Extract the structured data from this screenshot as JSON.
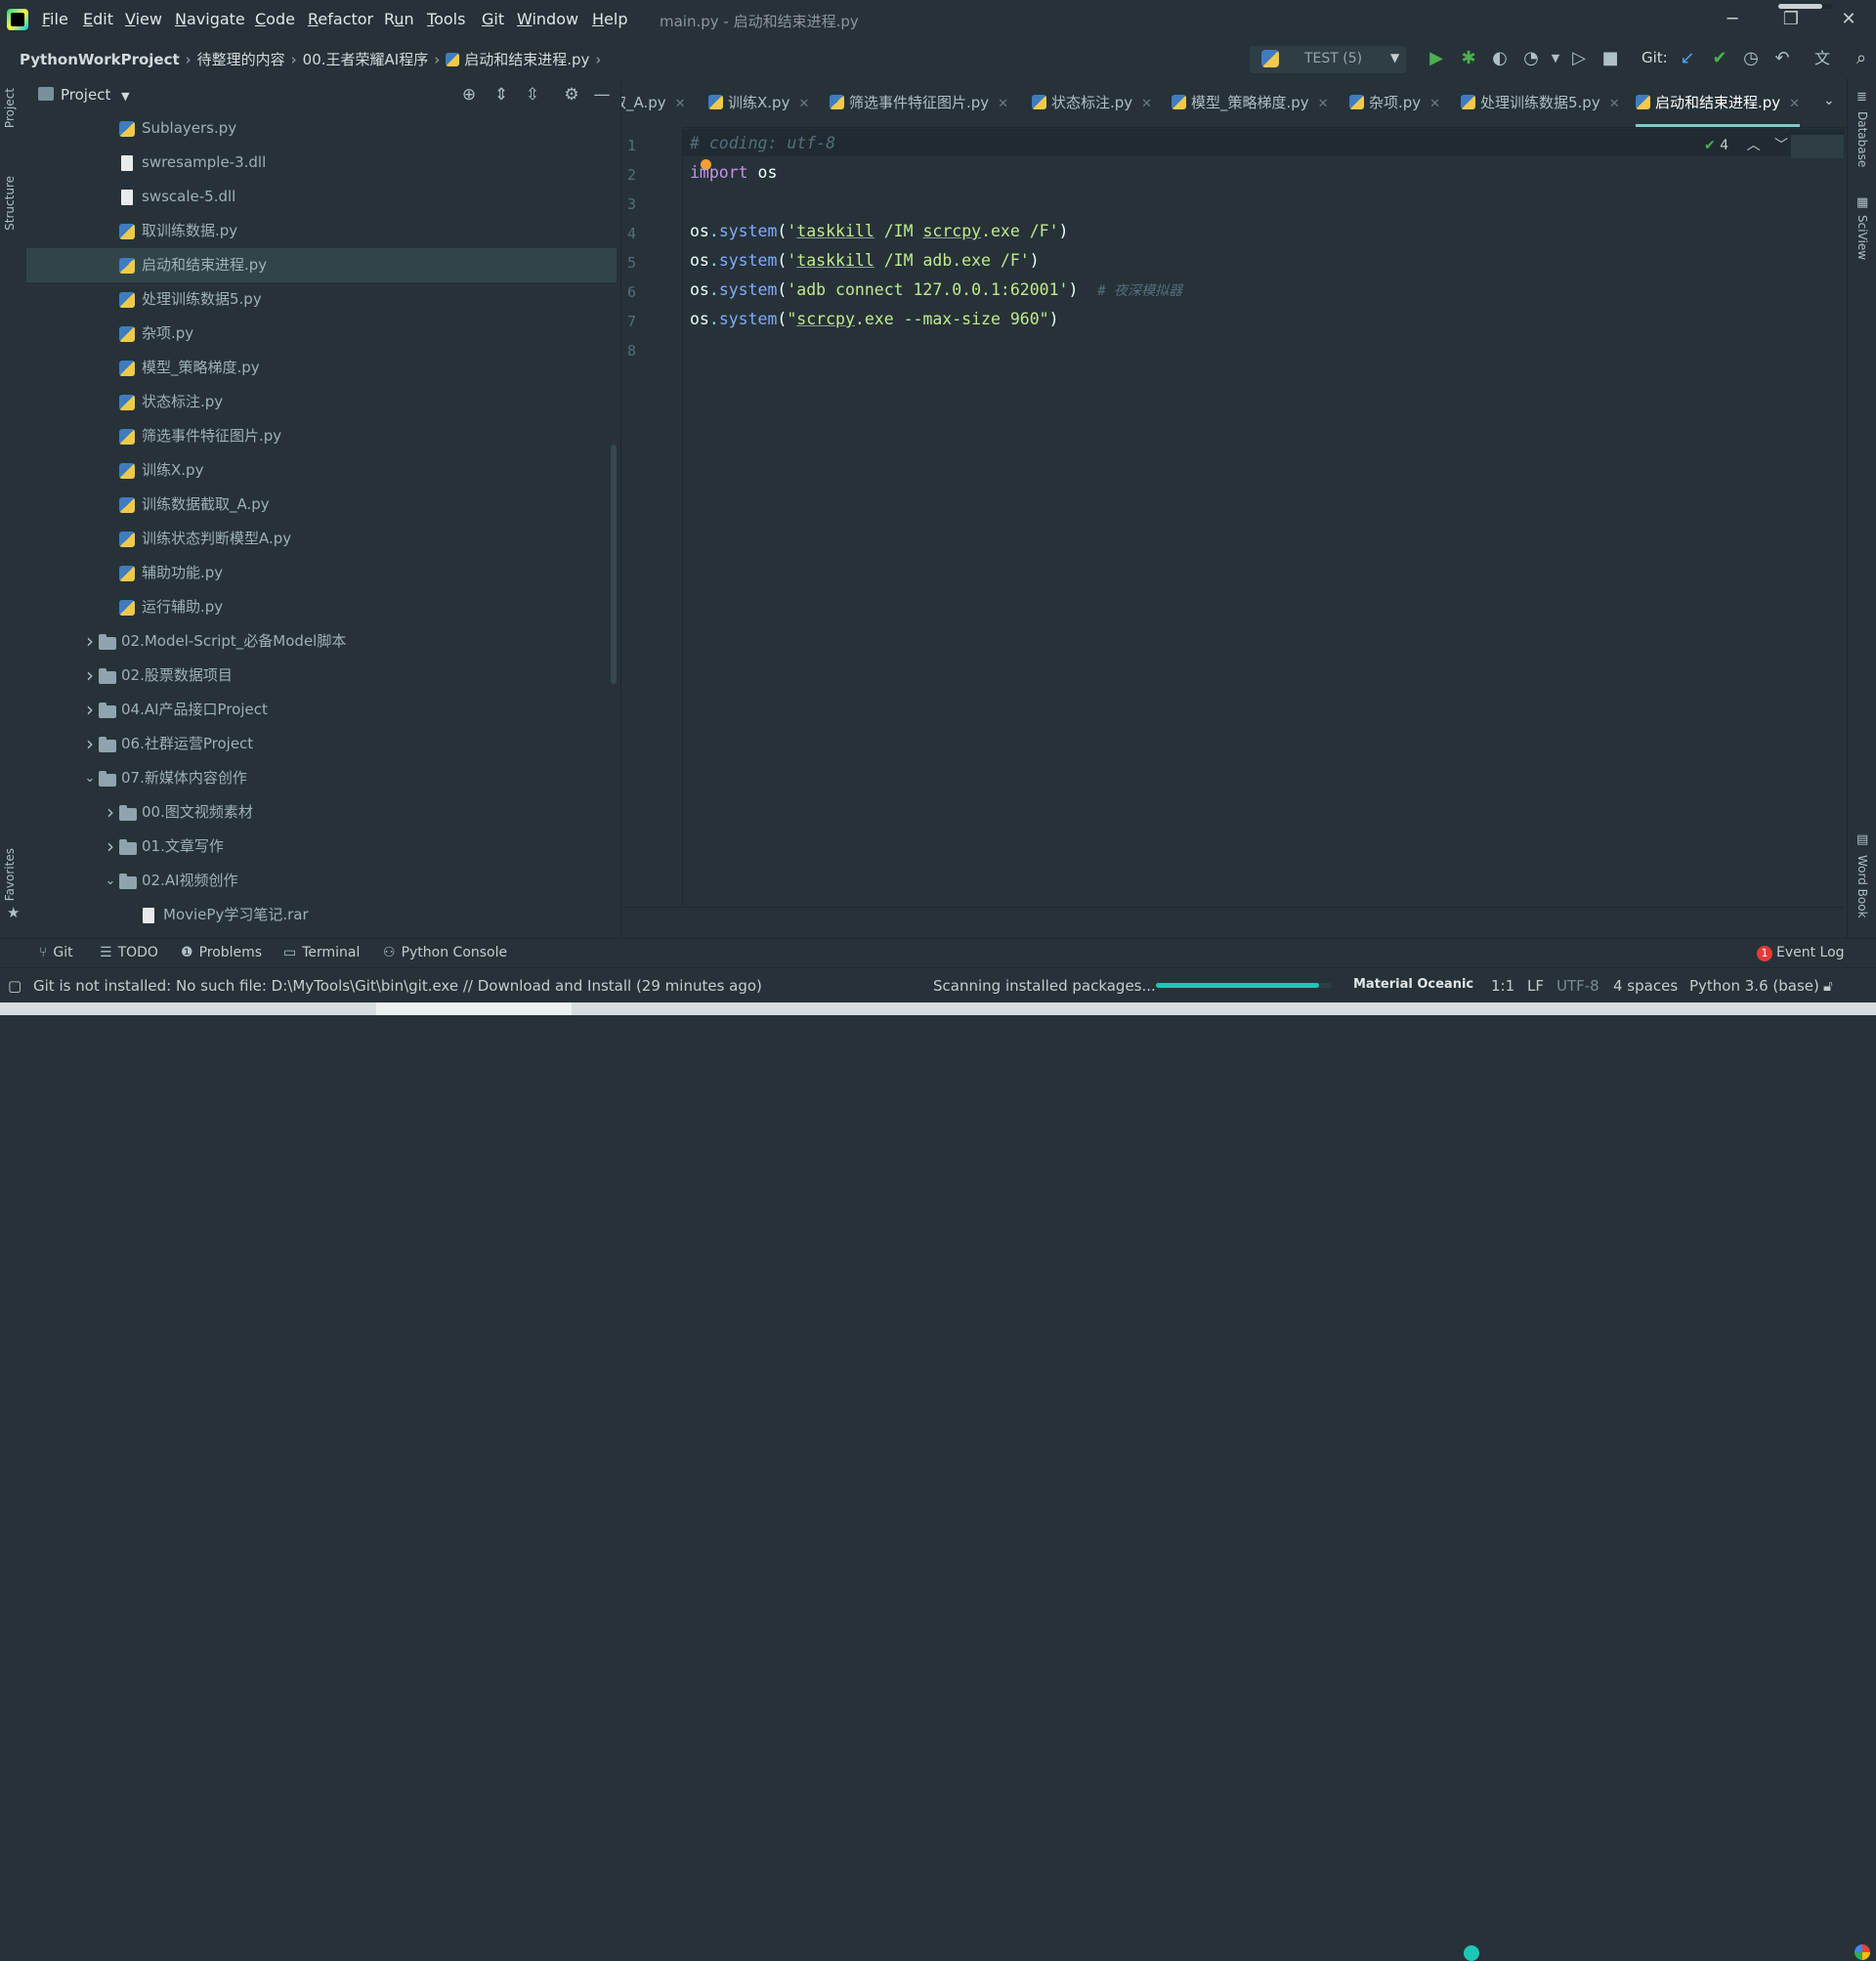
{
  "window": {
    "title": "main.py - 启动和结束进程.py",
    "minimize": "─",
    "restore": "❐",
    "close": "✕",
    "progress": 0.8
  },
  "menu": [
    {
      "pre": "",
      "u": "F",
      "post": "ile"
    },
    {
      "pre": "",
      "u": "E",
      "post": "dit"
    },
    {
      "pre": "",
      "u": "V",
      "post": "iew"
    },
    {
      "pre": "",
      "u": "N",
      "post": "avigate"
    },
    {
      "pre": "",
      "u": "C",
      "post": "ode"
    },
    {
      "pre": "",
      "u": "R",
      "post": "efactor"
    },
    {
      "pre": "R",
      "u": "u",
      "post": "n"
    },
    {
      "pre": "",
      "u": "T",
      "post": "ools"
    },
    {
      "pre": "",
      "u": "G",
      "post": "it"
    },
    {
      "pre": "",
      "u": "W",
      "post": "indow"
    },
    {
      "pre": "",
      "u": "H",
      "post": "elp"
    }
  ],
  "breadcrumb": {
    "project": "PythonWorkProject",
    "folder1": "待整理的内容",
    "folder2": "00.王者荣耀AI程序",
    "file": "启动和结束进程.py"
  },
  "toolbar": {
    "run_config": "TEST (5)",
    "git_label": "Git:"
  },
  "left_tabs": {
    "project": "Project",
    "structure": "Structure",
    "favorites": "Favorites"
  },
  "project_panel": {
    "title": "Project",
    "tree": [
      {
        "label": "Sublayers.py",
        "type": "py"
      },
      {
        "label": "swresample-3.dll",
        "type": "file"
      },
      {
        "label": "swscale-5.dll",
        "type": "file"
      },
      {
        "label": "取训练数据.py",
        "type": "py"
      },
      {
        "label": "启动和结束进程.py",
        "type": "py"
      },
      {
        "label": "处理训练数据5.py",
        "type": "py"
      },
      {
        "label": "杂项.py",
        "type": "py"
      },
      {
        "label": "模型_策略梯度.py",
        "type": "py"
      },
      {
        "label": "状态标注.py",
        "type": "py"
      },
      {
        "label": "筛选事件特征图片.py",
        "type": "py"
      },
      {
        "label": "训练X.py",
        "type": "py"
      },
      {
        "label": "训练数据截取_A.py",
        "type": "py"
      },
      {
        "label": "训练状态判断模型A.py",
        "type": "py"
      },
      {
        "label": "辅助功能.py",
        "type": "py"
      },
      {
        "label": "运行辅助.py",
        "type": "py"
      },
      {
        "label": "02.Model-Script_必备Model脚本",
        "type": "folder"
      },
      {
        "label": "02.股票数据项目",
        "type": "folder"
      },
      {
        "label": "04.AI产品接口Project",
        "type": "folder"
      },
      {
        "label": "06.社群运营Project",
        "type": "folder"
      },
      {
        "label": "07.新媒体内容创作",
        "type": "folder"
      },
      {
        "label": "00.图文视频素材",
        "type": "folder"
      },
      {
        "label": "01.文章写作",
        "type": "folder"
      },
      {
        "label": "02.AI视频创作",
        "type": "folder"
      },
      {
        "label": "MoviePy学习笔记.rar",
        "type": "file"
      }
    ]
  },
  "tabs": [
    {
      "label": "取_A.py"
    },
    {
      "label": "训练X.py"
    },
    {
      "label": "筛选事件特征图片.py"
    },
    {
      "label": "状态标注.py"
    },
    {
      "label": "模型_策略梯度.py"
    },
    {
      "label": "杂项.py"
    },
    {
      "label": "处理训练数据5.py"
    },
    {
      "label": "启动和结束进程.py"
    }
  ],
  "editor": {
    "line_numbers": [
      "1",
      "2",
      "3",
      "4",
      "5",
      "6",
      "7",
      "8"
    ],
    "inspection_count": "4",
    "code": {
      "l1": "# coding: utf-8",
      "l2_kw": "import",
      "l2_rest": " os",
      "os": "os",
      "dot": ".",
      "system": "system",
      "open": "(",
      "close": ")",
      "l4_q": "'",
      "l4_a": "taskkill",
      "l4_b": " /IM ",
      "l4_c": "scrcpy",
      "l4_d": ".exe /F'",
      "l5_a": "taskkill",
      "l5_b": " /IM adb.exe /F'",
      "l6_str": "'adb connect 127.0.0.1:62001'",
      "l6_comment": "# 夜深模拟器",
      "l7_q": "\"",
      "l7_a": "scrcpy",
      "l7_b": ".exe --max-size 960\""
    }
  },
  "right_tabs": {
    "database": "Database",
    "sciview": "SciView",
    "wordbook": "Word Book"
  },
  "bottom_tools": {
    "git": "Git",
    "todo": "TODO",
    "problems": "Problems",
    "terminal": "Terminal",
    "python_console": "Python Console",
    "event_log": "Event Log",
    "event_count": "1"
  },
  "status": {
    "message": "Git is not installed: No such file: D:\\MyTools\\Git\\bin\\git.exe // Download and Install (29 minutes ago)",
    "scanning": "Scanning installed packages...",
    "scan_progress": 0.93,
    "theme": "Material Oceanic",
    "position": "1:1",
    "line_sep": "LF",
    "encoding": "UTF-8",
    "indent": "4 spaces",
    "interpreter": "Python 3.6 (base)"
  },
  "colors": {
    "background": "#263238",
    "accent": "#80cbc4",
    "selection": "#314549"
  }
}
